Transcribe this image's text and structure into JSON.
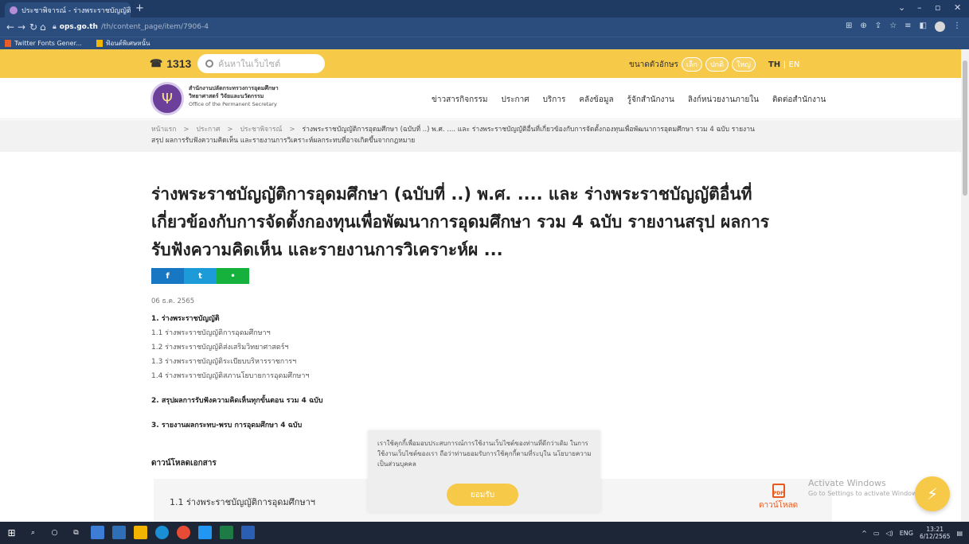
{
  "browser": {
    "tab_title": "ประชาพิจารณ์ - ร่างพระราชบัญญัติการ...",
    "tab_close": "×",
    "new_tab": "+",
    "url_host": "ops.go.th",
    "url_path": "/th/content_page/item/7906-4",
    "bookmarks": [
      {
        "label": "Twitter Fonts Gener..."
      },
      {
        "label": "ฟ้อนต์พิเศษหนั้น"
      }
    ]
  },
  "topbar": {
    "hotline": "1313",
    "search_placeholder": "ค้นหาในเว็บไซต์",
    "fontsize_label": "ขนาดตัวอักษร",
    "fontsize_options": [
      "เล็ก",
      "ปกติ",
      "ใหญ่"
    ],
    "lang_th": "TH",
    "lang_sep": "|",
    "lang_en": "EN"
  },
  "header": {
    "org_th_1": "สำนักงานปลัดกระทรวงการอุดมศึกษา",
    "org_th_2": "วิทยาศาสตร์ วิจัยและนวัตกรรม",
    "org_en": "Office of the Permanent Secretary",
    "nav": [
      "ข่าวสารกิจกรรม",
      "ประกาศ",
      "บริการ",
      "คลังข้อมูล",
      "รู้จักสำนักงาน",
      "ลิงก์หน่วยงานภายใน",
      "ติดต่อสำนักงาน"
    ]
  },
  "breadcrumb": {
    "items": [
      "หน้าแรก",
      "ประกาศ",
      "ประชาพิจารณ์"
    ],
    "sep": ">",
    "current_line1": "ร่างพระราชบัญญัติการอุดมศึกษา (ฉบับที่ ..) พ.ศ. .... และ ร่างพระราชบัญญัติอื่นที่เกี่ยวข้องกับการจัดตั้งกองทุนเพื่อพัฒนาการอุดมศึกษา รวม 4 ฉบับ รายงาน",
    "current_line2": "สรุป ผลการรับฟังความคิดเห็น และรายงานการวิเคราะห์ผลกระทบที่อาจเกิดขึ้นจากกฎหมาย"
  },
  "article": {
    "title_line1": "ร่างพระราชบัญญัติการอุดมศึกษา (ฉบับที่ ..) พ.ศ. .... และ ร่างพระราชบัญญัติอื่นที่",
    "title_line2": "เกี่ยวข้องกับการจัดตั้งกองทุนเพื่อพัฒนาการอุดมศึกษา รวม 4 ฉบับ รายงานสรุป ผลการ",
    "title_line3": "รับฟังความคิดเห็น และรายงานการวิเคราะห์ผ ...",
    "share": {
      "facebook": "f",
      "twitter": "t",
      "line": "•"
    },
    "date": "06 ธ.ค. 2565",
    "section1_heading": "1. ร่างพระราชบัญญัติ",
    "section1_items": [
      "1.1 ร่างพระราชบัญญัติการอุดมศึกษาฯ",
      "1.2 ร่างพระราชบัญญัติส่งเสริมวิทยาศาสตร์ฯ",
      "1.3 ร่างพระราชบัญญัติระเบียบบริหารราชการฯ",
      "1.4 ร่างพระราชบัญญัติสภานโยบายการอุดมศึกษาฯ"
    ],
    "section2_heading": "2. สรุปผลการรับฟังความคิดเห็นทุกขั้นตอน รวม 4 ฉบับ",
    "section3_heading": "3. รายงานผลกระทบ-พรบ การอุดมศึกษา 4 ฉบับ",
    "download_heading": "ดาวน์โหลดเอกสาร",
    "download_item": "1.1 ร่างพระราชบัญญัติการอุดมศึกษาฯ",
    "download_button": "ดาวน์โหลด",
    "pdf_label": "PDF"
  },
  "cookie": {
    "text": "เราใช้คุกกี้เพื่อมอบประสบการณ์การใช้งานเว็บไซต์ของท่านที่ดีกว่าเดิม ในการใช้งานเว็บไซต์ของเรา ถือว่าท่านยอมรับการใช้คุกกี้ตามที่ระบุใน นโยบายความเป็นส่วนบุคคล",
    "accept": "ยอมรับ"
  },
  "watermark": {
    "line1": "Activate Windows",
    "line2": "Go to Settings to activate Windows."
  },
  "taskbar": {
    "lang": "ENG",
    "time": "13:21",
    "date": "6/12/2565"
  },
  "colors": {
    "brand_yellow": "#f7c948",
    "chrome_blue": "#2b4d7d",
    "pdf_orange": "#e85a1b"
  }
}
